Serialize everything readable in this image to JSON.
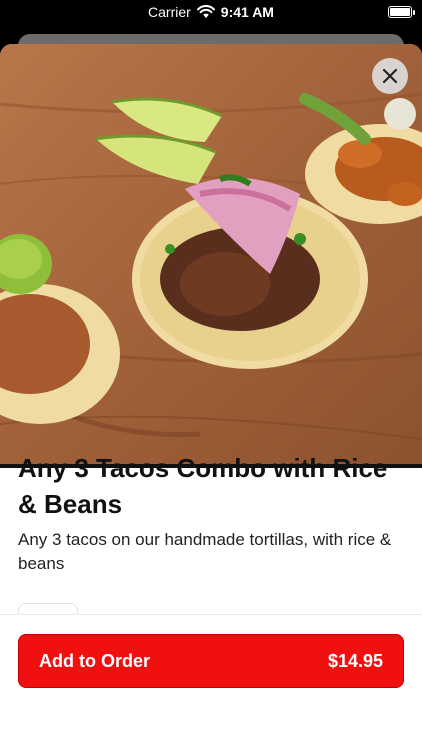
{
  "status_bar": {
    "carrier": "Carrier",
    "time": "9:41 AM"
  },
  "item": {
    "title": "Any 3 Tacos Combo with Rice & Beans",
    "description": "Any 3 tacos on our handmade tortillas, with rice & beans",
    "image_alt": "tacos-photo"
  },
  "order_button": {
    "label": "Add to Order",
    "price": "$14.95"
  },
  "colors": {
    "accent": "#f01010",
    "wood": "#a9683f"
  }
}
